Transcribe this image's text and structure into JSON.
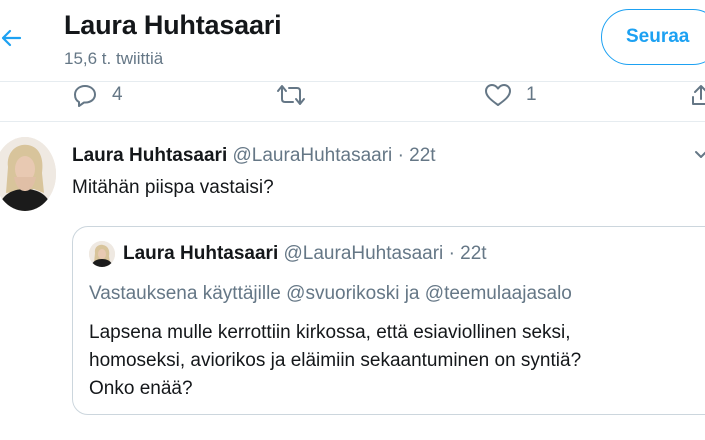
{
  "header": {
    "title": "Laura Huhtasaari",
    "subtitle": "15,6 t. twiittiä",
    "follow_label": "Seuraa"
  },
  "actions": {
    "reply_count": "4",
    "like_count": "1"
  },
  "tweet": {
    "name": "Laura Huhtasaari",
    "handle": "@LauraHuhtasaari",
    "separator": "·",
    "time": "22t",
    "text": "Mitähän piispa vastaisi?"
  },
  "quote": {
    "name": "Laura Huhtasaari",
    "handle": "@LauraHuhtasaari",
    "separator": "·",
    "time": "22t",
    "reply_prefix": "Vastauksena käyttäjille",
    "mention_1": "@svuorikoski",
    "reply_joiner": "ja",
    "mention_2": "@teemulaajasalo",
    "text_line_1": "Lapsena mulle kerrottiin kirkossa, että esiaviollinen seksi,",
    "text_line_2": "homoseksi, aviorikos ja eläimiin sekaantuminen on syntiä?",
    "text_line_3": "Onko enää?"
  },
  "colors": {
    "accent": "#1da1f2",
    "secondary_text": "#657786",
    "primary_text": "#14171a",
    "border": "#e6ecf0"
  },
  "icons": [
    "back-arrow-icon",
    "reply-icon",
    "retweet-icon",
    "like-icon",
    "share-icon",
    "chevron-down-icon"
  ]
}
